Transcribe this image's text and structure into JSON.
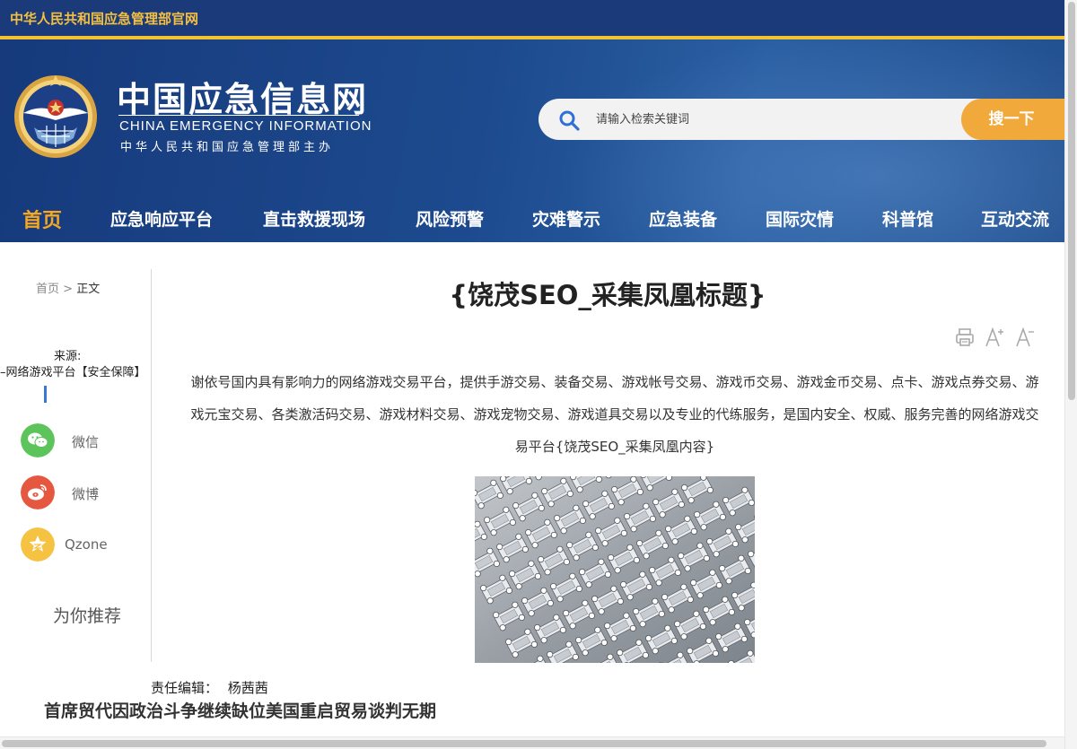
{
  "top_bar": {
    "site_name": "中华人民共和国应急管理部官网"
  },
  "header": {
    "logo_cn": "中国应急信息网",
    "logo_en": "CHINA EMERGENCY INFORMATION",
    "logo_sub": "中华人民共和国应急管理部主办",
    "search": {
      "placeholder": "请输入检索关键词",
      "button_label": "搜一下"
    }
  },
  "nav": {
    "items": [
      "首页",
      "应急响应平台",
      "直击救援现场",
      "风险预警",
      "灾难警示",
      "应急装备",
      "国际灾情",
      "科普馆",
      "互动交流"
    ],
    "active": "首页"
  },
  "breadcrumb": {
    "home": "首页",
    "separator": ">",
    "current": "正文"
  },
  "sidebar": {
    "source_label": "来源:",
    "source_value": "–网络游戏平台【安全保障】",
    "share": [
      {
        "label": "微信",
        "icon": "wechat-icon",
        "color": "#5cc45a"
      },
      {
        "label": "微博",
        "icon": "weibo-icon",
        "color": "#e6573f"
      },
      {
        "label": "Qzone",
        "icon": "qzone-icon",
        "color": "#f5c242"
      }
    ],
    "recommend": "为你推荐"
  },
  "article": {
    "title": "{饶茂SEO_采集凤凰标题}",
    "body": "谢依号国内具有影响力的网络游戏交易平台，提供手游交易、装备交易、游戏帐号交易、游戏币交易、游戏金币交易、点卡、游戏点券交易、游戏元宝交易、各类激活码交易、游戏材料交易、游戏宠物交易、游戏道具交易以及专业的代练服务，是国内安全、权威、服务完善的网络游戏交易平台{饶茂SEO_采集凤凰内容}",
    "tools": {
      "print_icon": "print-icon",
      "font_larger_icon": "font-increase-icon",
      "font_smaller_icon": "font-decrease-icon"
    },
    "editor_label": "责任编辑：",
    "editor_name": "杨茜茜",
    "related_headline": "首席贸代因政治斗争继续缺位美国重启贸易谈判无期"
  },
  "colors": {
    "header_blue": "#1d4a8e",
    "gold": "#f2c230",
    "search_button": "#f2a93b",
    "nav_active": "#f5a623"
  }
}
